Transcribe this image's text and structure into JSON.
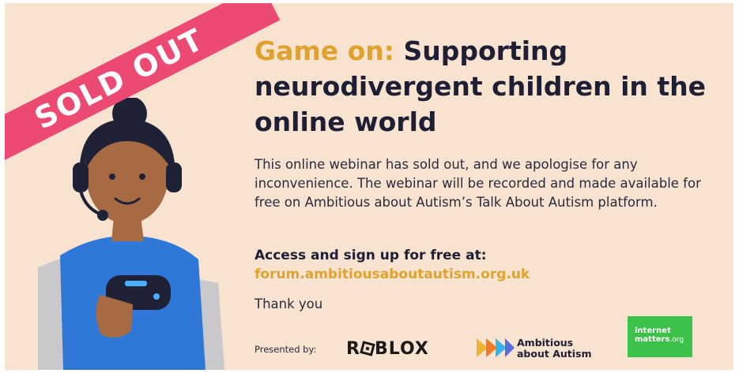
{
  "banner": {
    "label": "SOLD OUT"
  },
  "title": {
    "accent": "Game on:",
    "rest": "Supporting neurodivergent children in the online world"
  },
  "description": "This online webinar has sold out, and we apologise for any inconvenience. The webinar will be recorded and made available for free on Ambitious about Autism’s Talk About Autism platform.",
  "access": {
    "label": "Access and sign up for free at:",
    "url": "forum.ambitiousaboutautism.org.uk"
  },
  "thanks": "Thank you",
  "sponsors": {
    "presented_by": "Presented by:",
    "roblox": {
      "r": "R",
      "rest": "BLOX"
    },
    "ambitious": {
      "line1": "Ambitious",
      "line2": "about Autism"
    },
    "internet_matters": {
      "line1": "internet",
      "line2_a": "matters",
      "line2_b": ".org"
    }
  },
  "colors": {
    "background": "#f7e3cf",
    "banner": "#ec4a72",
    "accent": "#e0a22f",
    "heading": "#1e1e35",
    "internet_matters_green": "#3cc24a"
  },
  "icons": [
    "headset-icon",
    "game-controller-icon"
  ]
}
